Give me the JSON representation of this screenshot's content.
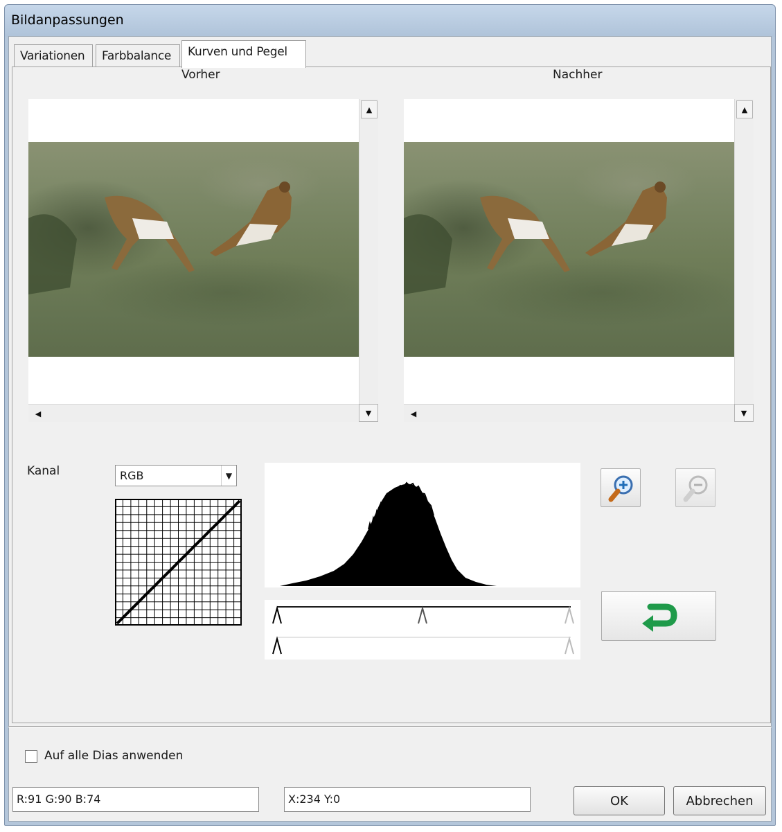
{
  "window": {
    "title": "Bildanpassungen"
  },
  "tabs": [
    {
      "label": "Variationen",
      "active": false
    },
    {
      "label": "Farbbalance",
      "active": false
    },
    {
      "label": "Kurven und Pegel",
      "active": true
    }
  ],
  "preview": {
    "before_label": "Vorher",
    "after_label": "Nachher"
  },
  "channel": {
    "label": "Kanal",
    "value": "RGB"
  },
  "apply_all": {
    "label": "Auf alle Dias anwenden",
    "checked": false
  },
  "status": {
    "color_readout": "R:91 G:90 B:74",
    "position_readout": "X:234 Y:0"
  },
  "buttons": {
    "ok": "OK",
    "cancel": "Abbrechen"
  },
  "icons": {
    "zoom_in": "zoom-in-icon",
    "zoom_out": "zoom-out-icon",
    "reset": "undo-arrow-icon"
  },
  "colors": {
    "accent_green": "#1f9a4a",
    "window_frame": "#b4c6da"
  }
}
